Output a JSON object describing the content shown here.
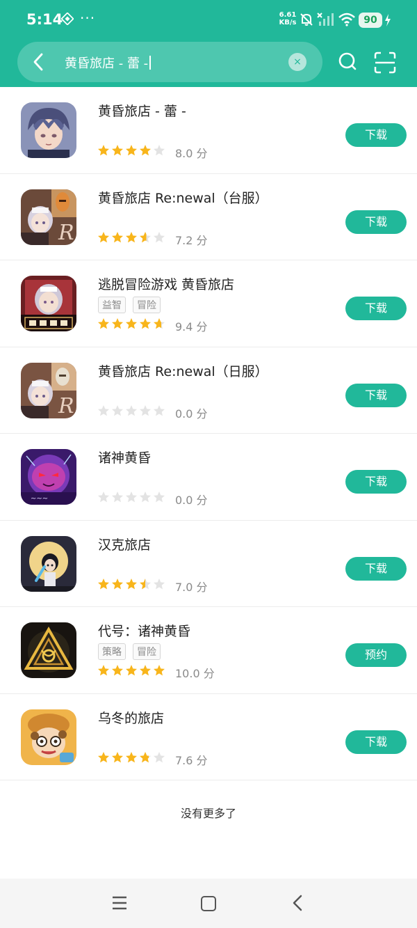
{
  "status_bar": {
    "time": "5:14",
    "dots": "···",
    "speed_value": "6.61",
    "speed_unit": "KB/s",
    "battery": "90"
  },
  "search": {
    "query": "黄昏旅店 - 蕾 -",
    "clear_icon": "×"
  },
  "apps": [
    {
      "name": "黄昏旅店 - 蕾 -",
      "tags": [],
      "rating": 8.0,
      "rating_label": "8.0 分",
      "button": "下载",
      "icon": "anime-boy-icon"
    },
    {
      "name": "黄昏旅店 Re:newal（台服）",
      "tags": [],
      "rating": 7.2,
      "rating_label": "7.2 分",
      "button": "下载",
      "icon": "hotel-maid-icon"
    },
    {
      "name": "逃脱冒险游戏 黄昏旅店",
      "tags": [
        "益智",
        "冒险"
      ],
      "rating": 9.4,
      "rating_label": "9.4 分",
      "button": "下载",
      "icon": "twilight-hotel-icon"
    },
    {
      "name": "黄昏旅店 Re:newal（日服）",
      "tags": [],
      "rating": 0.0,
      "rating_label": "0.0 分",
      "button": "下载",
      "icon": "hotel-maid-icon"
    },
    {
      "name": "诸神黄昏",
      "tags": [],
      "rating": 0.0,
      "rating_label": "0.0 分",
      "button": "下载",
      "icon": "ragnarok-icon"
    },
    {
      "name": "汉克旅店",
      "tags": [],
      "rating": 7.0,
      "rating_label": "7.0 分",
      "button": "下载",
      "icon": "moon-girl-icon"
    },
    {
      "name": "代号：诸神黄昏",
      "tags": [
        "策略",
        "冒险"
      ],
      "rating": 10.0,
      "rating_label": "10.0 分",
      "button": "预约",
      "icon": "triangle-emblem-icon"
    },
    {
      "name": "乌冬的旅店",
      "tags": [],
      "rating": 7.6,
      "rating_label": "7.6 分",
      "button": "下载",
      "icon": "cartoon-chef-icon"
    }
  ],
  "footer": "没有更多了",
  "colors": {
    "accent": "#21b89a",
    "star": "#f8b51b",
    "star_empty": "#e3e3e3"
  }
}
